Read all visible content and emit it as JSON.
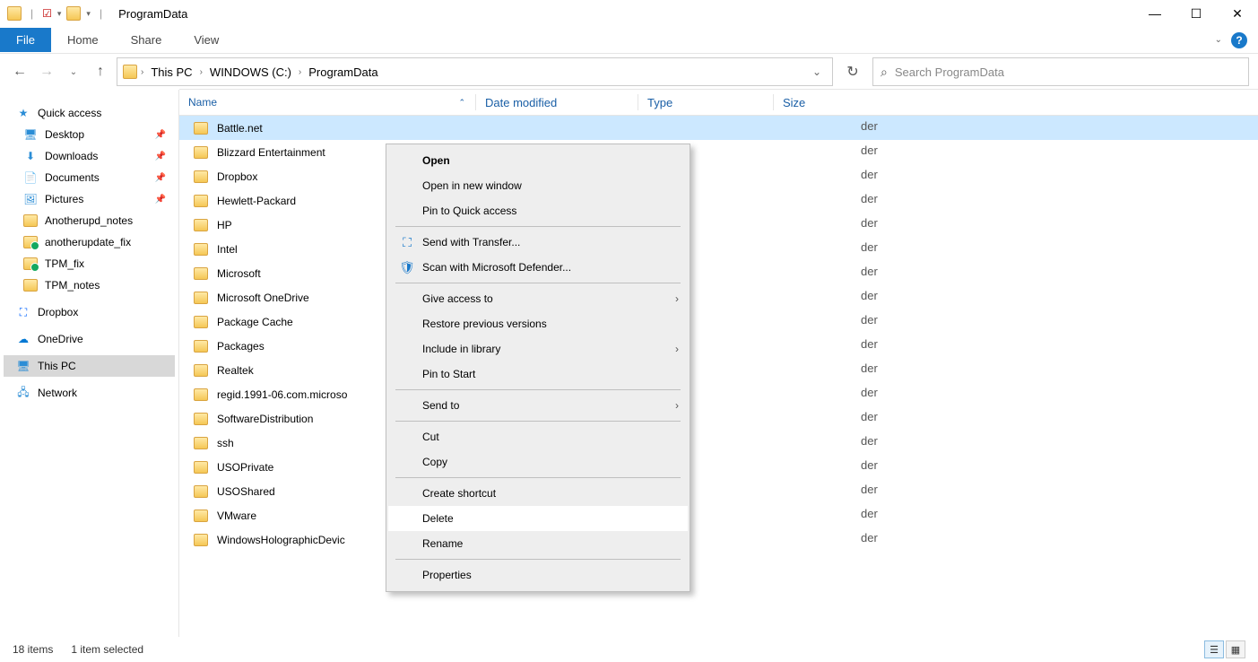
{
  "window": {
    "title": "ProgramData"
  },
  "ribbon": {
    "file": "File",
    "home": "Home",
    "share": "Share",
    "view": "View"
  },
  "nav": {
    "back": "←",
    "forward": "→",
    "up": "↑"
  },
  "breadcrumbs": {
    "root": "This PC",
    "drive": "WINDOWS (C:)",
    "folder": "ProgramData"
  },
  "refresh": "↻",
  "search": {
    "placeholder": "Search ProgramData"
  },
  "sidebar": {
    "quickaccess": "Quick access",
    "desktop": "Desktop",
    "downloads": "Downloads",
    "documents": "Documents",
    "pictures": "Pictures",
    "anotherupd": "Anotherupd_notes",
    "anotherupdate_fix": "anotherupdate_fix",
    "tpm_fix": "TPM_fix",
    "tpm_notes": "TPM_notes",
    "dropbox": "Dropbox",
    "onedrive": "OneDrive",
    "thispc": "This PC",
    "network": "Network"
  },
  "columns": {
    "name": "Name",
    "date": "Date modified",
    "type": "Type",
    "size": "Size"
  },
  "rows": {
    "r0": {
      "name": "Battle.net",
      "type_partial": "der"
    },
    "r1": {
      "name": "Blizzard Entertainment",
      "type_partial": "der"
    },
    "r2": {
      "name": "Dropbox",
      "type_partial": "der"
    },
    "r3": {
      "name": "Hewlett-Packard",
      "type_partial": "der"
    },
    "r4": {
      "name": "HP",
      "type_partial": "der"
    },
    "r5": {
      "name": "Intel",
      "type_partial": "der"
    },
    "r6": {
      "name": "Microsoft",
      "type_partial": "der"
    },
    "r7": {
      "name": "Microsoft OneDrive",
      "type_partial": "der"
    },
    "r8": {
      "name": "Package Cache",
      "type_partial": "der"
    },
    "r9": {
      "name": "Packages",
      "type_partial": "der"
    },
    "r10": {
      "name": "Realtek",
      "type_partial": "der"
    },
    "r11": {
      "name": "regid.1991-06.com.microso",
      "type_partial": "der"
    },
    "r12": {
      "name": "SoftwareDistribution",
      "type_partial": "der"
    },
    "r13": {
      "name": "ssh",
      "type_partial": "der"
    },
    "r14": {
      "name": "USOPrivate",
      "type_partial": "der"
    },
    "r15": {
      "name": "USOShared",
      "type_partial": "der"
    },
    "r16": {
      "name": "VMware",
      "type_partial": "der"
    },
    "r17": {
      "name": "WindowsHolographicDevic",
      "type_partial": "der"
    }
  },
  "contextmenu": {
    "open": "Open",
    "open_new": "Open in new window",
    "pin_qa": "Pin to Quick access",
    "send_transfer": "Send with Transfer...",
    "scan_defender": "Scan with Microsoft Defender...",
    "give_access": "Give access to",
    "restore_prev": "Restore previous versions",
    "include_lib": "Include in library",
    "pin_start": "Pin to Start",
    "send_to": "Send to",
    "cut": "Cut",
    "copy": "Copy",
    "create_shortcut": "Create shortcut",
    "delete": "Delete",
    "rename": "Rename",
    "properties": "Properties"
  },
  "status": {
    "items": "18 items",
    "selected": "1 item selected"
  }
}
